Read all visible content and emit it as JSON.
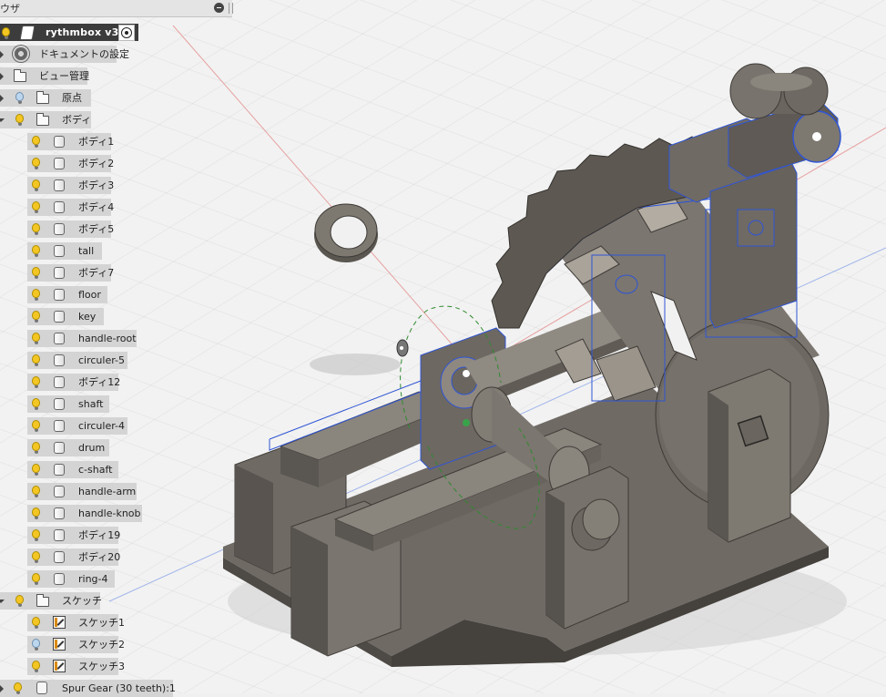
{
  "browser": {
    "title": "ウザ",
    "root": {
      "label": "rythmbox v3"
    },
    "items": [
      {
        "label": "ドキュメントの設定",
        "type": "settings",
        "expanded": false
      },
      {
        "label": "ビュー管理",
        "type": "folder",
        "expanded": false
      },
      {
        "label": "原点",
        "type": "folder",
        "expanded": false,
        "light": "off"
      },
      {
        "label": "ボディ",
        "type": "folder",
        "expanded": true,
        "light": "on"
      }
    ],
    "bodies": [
      {
        "label": "ボディ1"
      },
      {
        "label": "ボディ2"
      },
      {
        "label": "ボディ3"
      },
      {
        "label": "ボディ4"
      },
      {
        "label": "ボディ5"
      },
      {
        "label": "tall"
      },
      {
        "label": "ボディ7"
      },
      {
        "label": "floor"
      },
      {
        "label": "key"
      },
      {
        "label": "handle-root"
      },
      {
        "label": "circuler-5"
      },
      {
        "label": "ボディ12"
      },
      {
        "label": "shaft"
      },
      {
        "label": "circuler-4"
      },
      {
        "label": "drum"
      },
      {
        "label": "c-shaft"
      },
      {
        "label": "handle-arm"
      },
      {
        "label": "handle-knob"
      },
      {
        "label": "ボディ19"
      },
      {
        "label": "ボディ20"
      },
      {
        "label": "ring-4"
      }
    ],
    "sketch_folder": {
      "label": "スケッチ",
      "expanded": true
    },
    "sketches": [
      {
        "label": "スケッチ1",
        "light": "on"
      },
      {
        "label": "スケッチ2",
        "light": "off"
      },
      {
        "label": "スケッチ3",
        "light": "on"
      }
    ],
    "component": {
      "label": "Spur Gear (30 teeth):1"
    }
  },
  "colors": {
    "model_body": "#7a756e",
    "model_dark": "#4f4b46",
    "selection": "#2f55d4",
    "axis_red": "#e38a8a",
    "axis_blue": "#7f9be0"
  }
}
